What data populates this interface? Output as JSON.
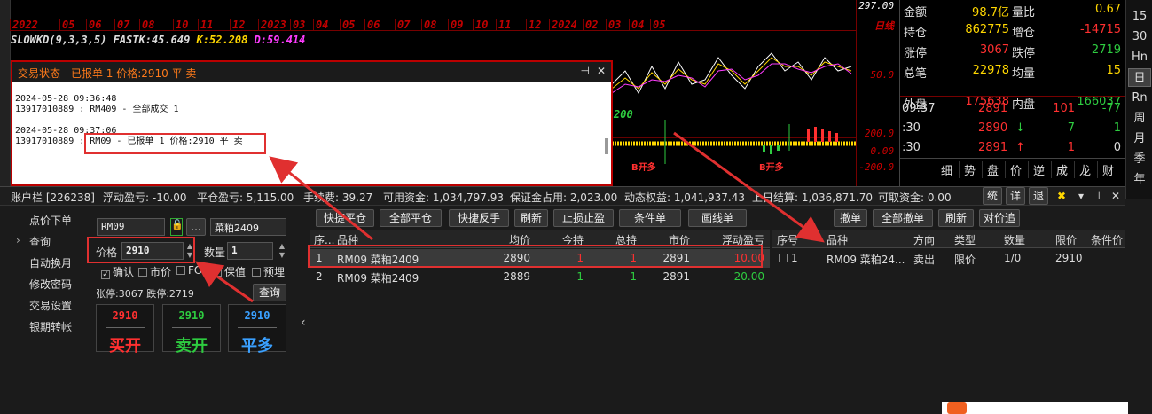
{
  "chart": {
    "date_labels": [
      "2022",
      "05",
      "06",
      "07",
      "08",
      "10",
      "11",
      "12",
      "2023",
      "03",
      "04",
      "05",
      "06",
      "07",
      "08",
      "09",
      "10",
      "11",
      "12",
      "2024",
      "02",
      "03",
      "04",
      "05"
    ],
    "period_label": "日线",
    "indicator": {
      "name": "SLOWKD(9,3,3,5)",
      "fastk": "FASTK:45.649",
      "k": "K:52.208",
      "d": "D:59.414"
    },
    "top_axis": "297.00",
    "kd_axis": "50.0",
    "macd_axis": [
      "200.0",
      "0.00",
      "-200.0"
    ],
    "macd_label": "200",
    "buy_tags": [
      "B开多",
      "B开多",
      "B开多"
    ]
  },
  "quote": {
    "rows": [
      {
        "l1": "金额",
        "v1": "98.7亿",
        "l2": "量比",
        "v2": "0.67"
      },
      {
        "l1": "持仓",
        "v1": "862775",
        "l2": "增仓",
        "v2": "-14715"
      },
      {
        "l1": "涨停",
        "v1": "3067",
        "l2": "跌停",
        "v2": "2719"
      },
      {
        "l1": "总笔",
        "v1": "22978",
        "l2": "均量",
        "v2": "15"
      },
      {
        "l1": "外盘",
        "v1": "175638",
        "l2": "内盘",
        "v2": "166037"
      }
    ],
    "ticks": [
      {
        "time": "09:37",
        "price": "2891",
        "vol": "101",
        "chg": "-77"
      },
      {
        "time": ":30",
        "price": "2890",
        "arrow": "↓",
        "vol": "7",
        "chg": "1"
      },
      {
        "time": ":30",
        "price": "2891",
        "arrow": "↑",
        "vol": "1",
        "chg": "0"
      }
    ],
    "tabs": [
      "细",
      "势",
      "盘",
      "价",
      "逆",
      "成",
      "龙",
      "财"
    ]
  },
  "periods": [
    "15",
    "30",
    "Hn",
    "日",
    "Rn",
    "周",
    "月",
    "季",
    "年"
  ],
  "account_bar": [
    "账户栏 [226238]",
    "浮动盈亏: -10.00",
    "平仓盈亏: 5,115.00",
    "手续费: 39.27",
    "可用资金: 1,034,797.93",
    "保证金占用: 2,023.00",
    "动态权益: 1,041,937.43",
    "上日结算: 1,036,871.70",
    "可取资金: 0.00"
  ],
  "account_buttons": [
    "统",
    "详",
    "退"
  ],
  "nav": [
    "点价下单",
    "查询",
    "自动换月",
    "修改密码",
    "交易设置",
    "银期转帐"
  ],
  "order_form": {
    "contract": "RM09",
    "contract_name": "菜粕2409",
    "price_label": "价格",
    "price": "2910",
    "qty_label": "数量",
    "qty": "1",
    "checks": [
      "确认",
      "市价",
      "FOK",
      "保值",
      "预埋"
    ],
    "limit_info": "张停:3067 跌停:2719",
    "query_btn": "查询",
    "buttons": [
      {
        "price": "2910",
        "label": "买开"
      },
      {
        "price": "2910",
        "label": "卖开"
      },
      {
        "price": "2910",
        "label": "平多"
      }
    ]
  },
  "position_toolbar": [
    "快捷平仓",
    "全部平仓",
    "快捷反手",
    "刷新",
    "止损止盈",
    "条件单",
    "画线单"
  ],
  "position_headers": [
    "序...",
    "品种",
    "均价",
    "今持",
    "总持",
    "市价",
    "浮动盈亏"
  ],
  "positions": [
    [
      "1",
      "RM09 菜粕2409",
      "2890",
      "1",
      "1",
      "2891",
      "10.00"
    ],
    [
      "2",
      "RM09 菜粕2409",
      "2889",
      "-1",
      "-1",
      "2891",
      "-20.00"
    ]
  ],
  "order_toolbar": [
    "撤单",
    "全部撤单",
    "刷新",
    "对价追"
  ],
  "order_headers": [
    "序号",
    "品种",
    "方向",
    "类型",
    "数量",
    "限价",
    "条件价"
  ],
  "orders": [
    [
      "1",
      "RM09 菜粕24...",
      "卖出",
      "限价",
      "1/0",
      "2910",
      ""
    ]
  ],
  "popup": {
    "title": "交易状态 - 已报单 1 价格:2910 平 卖",
    "lines": [
      "2024-05-28 09:36:48",
      "13917010889 : RM409 - 全部成交 1",
      "",
      "2024-05-28 09:37:06",
      "13917010889 : RM09 - 已报单 1 价格:2910 平 卖"
    ]
  }
}
